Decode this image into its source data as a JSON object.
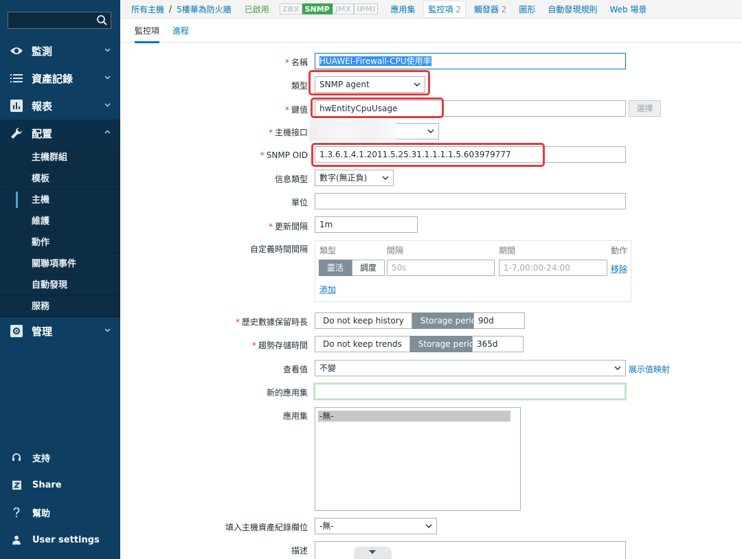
{
  "sidebar": {
    "search_placeholder": "",
    "menu": [
      {
        "label": "監測",
        "icon": "eye-icon"
      },
      {
        "label": "資產記錄",
        "icon": "list-icon"
      },
      {
        "label": "報表",
        "icon": "bar-chart-icon"
      },
      {
        "label": "配置",
        "icon": "wrench-icon"
      },
      {
        "label": "管理",
        "icon": "gear-icon"
      }
    ],
    "config_submenu": [
      "主機群組",
      "模板",
      "主機",
      "維護",
      "動作",
      "關聯項事件",
      "自動發現",
      "服務"
    ],
    "selected_submenu": "主機",
    "bottom": [
      {
        "label": "支持",
        "icon": "headset-icon"
      },
      {
        "label": "Share",
        "icon": "share-z-icon"
      },
      {
        "label": "幫助",
        "icon": "help-icon"
      },
      {
        "label": "User settings",
        "icon": "user-icon"
      }
    ]
  },
  "topnav": {
    "crumb_all_hosts": "所有主機",
    "separator": "/",
    "crumb_host": "5樓華為防火牆",
    "status": "已啟用",
    "badges": [
      {
        "label": "ZBX",
        "active": false
      },
      {
        "label": "SNMP",
        "active": true
      },
      {
        "label": "JMX",
        "active": false
      },
      {
        "label": "IPMI",
        "active": false
      }
    ],
    "applications": "應用集",
    "items": "監控項",
    "items_count": "2",
    "triggers": "觸發器",
    "triggers_count": "2",
    "graphs": "圖形",
    "discovery": "自動發現規則",
    "web": "Web 場景"
  },
  "tabs": {
    "item": "監控項",
    "process": "進程"
  },
  "form": {
    "name_label": "名稱",
    "name_value": "HUAWEI-Firewall-CPU使用率",
    "type_label": "類型",
    "type_value": "SNMP agent",
    "key_label": "鍵值",
    "key_value": "hwEntityCpuUsage",
    "select_button": "選擇",
    "interface_label": "主機接口",
    "interface_value": "",
    "oid_label": "SNMP OID",
    "oid_value": "1.3.6.1.4.1.2011.5.25.31.1.1.1.1.5.603979777",
    "info_type_label": "信息類型",
    "info_type_value": "數字(無正負)",
    "units_label": "單位",
    "units_value": "",
    "interval_label": "更新間隔",
    "interval_value": "1m",
    "custom_label": "自定義時間間隔",
    "custom": {
      "col_type": "類型",
      "col_interval": "間隔",
      "col_period": "期間",
      "col_action": "動作",
      "flexible": "靈活",
      "scheduling": "調度",
      "interval_placeholder": "50s",
      "period_placeholder": "1-7,00:00-24:00",
      "remove": "移除",
      "add": "添加"
    },
    "history_label": "歷史數據保留時長",
    "history_no_keep": "Do not keep history",
    "history_storage": "Storage period",
    "history_value": "90d",
    "trends_label": "趨勢存儲時間",
    "trends_no_keep": "Do not keep trends",
    "trends_storage": "Storage period",
    "trends_value": "365d",
    "show_value_label": "查看值",
    "show_value_value": "不變",
    "value_map_link": "展示值映射",
    "new_app_label": "新的應用集",
    "new_app_value": "",
    "apps_label": "應用集",
    "apps_option": "-無-",
    "inventory_label": "填入主機資產紀錄欄位",
    "inventory_value": "-無-",
    "description_label": "描述"
  },
  "colors": {
    "sidebar_bg": "#0e3f63",
    "link": "#0275b8",
    "required": "#e33734",
    "highlight": "#e33a3d",
    "snmp_badge": "#3da557"
  }
}
